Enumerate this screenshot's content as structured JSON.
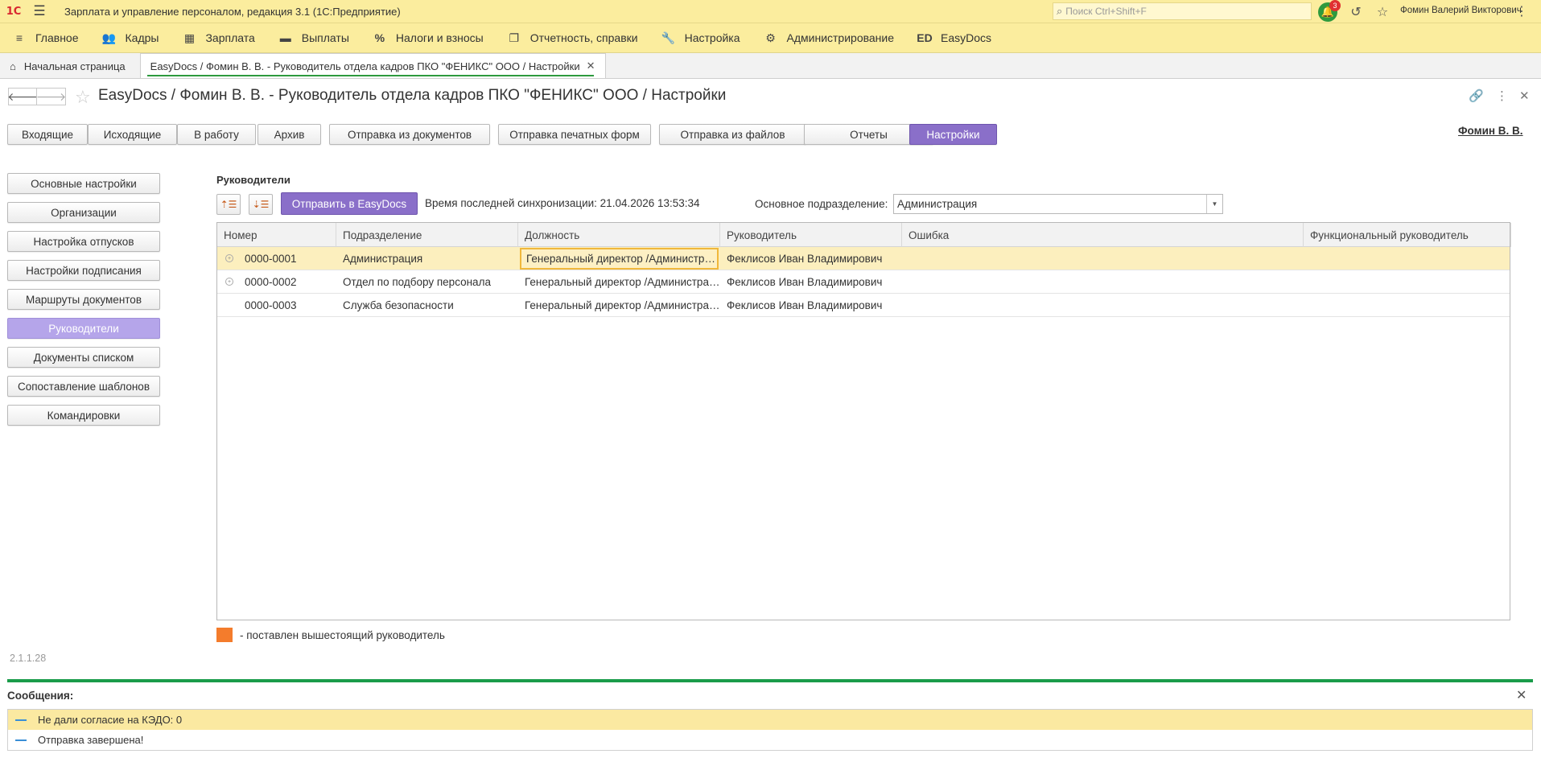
{
  "app": {
    "logo": "1С",
    "title": "Зарплата и управление персоналом, редакция 3.1  (1С:Предприятие)",
    "search_placeholder": "Поиск Ctrl+Shift+F",
    "notifications_count": "3",
    "user_name": "Фомин Валерий Викторович"
  },
  "sections": [
    {
      "label": "Главное",
      "icon": "≡",
      "icon_name": "menu-icon"
    },
    {
      "label": "Кадры",
      "icon": "👥",
      "icon_name": "people-icon"
    },
    {
      "label": "Зарплата",
      "icon": "▦",
      "icon_name": "calculator-icon"
    },
    {
      "label": "Выплаты",
      "icon": "▬",
      "icon_name": "wallet-icon"
    },
    {
      "label": "Налоги и взносы",
      "icon": "%",
      "icon_name": "percent-icon"
    },
    {
      "label": "Отчетность, справки",
      "icon": "❐",
      "icon_name": "documents-icon"
    },
    {
      "label": "Настройка",
      "icon": "🔧",
      "icon_name": "wrench-icon"
    },
    {
      "label": "Администрирование",
      "icon": "⚙",
      "icon_name": "gear-icon"
    },
    {
      "label": "EasyDocs",
      "icon": "ED",
      "icon_name": "easydocs-icon"
    }
  ],
  "open_tabs": {
    "home": "Начальная страница",
    "active": "EasyDocs / Фомин В. В. - Руководитель отдела кадров ПКО \"ФЕНИКС\" ООО / Настройки"
  },
  "form": {
    "title": "EasyDocs / Фомин В. В. - Руководитель отдела кадров ПКО \"ФЕНИКС\" ООО / Настройки",
    "user_link": "Фомин В. В.",
    "action_buttons": [
      "Входящие",
      "Исходящие",
      "В работу",
      "Архив",
      "Отправка из документов",
      "Отправка печатных форм",
      "Отправка из файлов",
      "Отчеты",
      "Настройки"
    ],
    "active_action": "Настройки"
  },
  "left_menu": {
    "items": [
      "Основные настройки",
      "Организации",
      "Настройка отпусков",
      "Настройки подписания",
      "Маршруты документов",
      "Руководители",
      "Документы списком",
      "Сопоставление шаблонов",
      "Командировки"
    ],
    "active": "Руководители",
    "version": "2.1.1.28"
  },
  "content": {
    "section_title": "Руководители",
    "send_button": "Отправить в EasyDocs",
    "sync_label": "Время последней синхронизации: 21.04.2026 13:53:34",
    "department_label": "Основное подразделение:",
    "department_value": "Администрация",
    "columns": [
      "Номер",
      "Подразделение",
      "Должность",
      "Руководитель",
      "Ошибка",
      "Функциональный руководитель"
    ],
    "rows": [
      {
        "number": "0000-0001",
        "department": "Администрация",
        "position": "Генеральный директор /Администрация",
        "manager": "Феклисов Иван Владимирович",
        "error": "",
        "functional": "",
        "expandable": true
      },
      {
        "number": "0000-0002",
        "department": "Отдел по подбору персонала",
        "position": "Генеральный директор /Администрация",
        "manager": "Феклисов Иван Владимирович",
        "error": "",
        "functional": "",
        "expandable": true
      },
      {
        "number": "0000-0003",
        "department": "Служба безопасности",
        "position": "Генеральный директор /Администрация",
        "manager": "Феклисов Иван Владимирович",
        "error": "",
        "functional": "",
        "expandable": false
      }
    ],
    "legend": "- поставлен вышестоящий руководитель",
    "legend_color": "#f47c2c"
  },
  "messages": {
    "title": "Сообщения:",
    "items": [
      "Не дали согласие на КЭДО: 0",
      "Отправка завершена!"
    ]
  },
  "colors": {
    "accent": "#8a6fc9",
    "accent_light": "#b5a5ea",
    "topbar": "#fbed9e",
    "selection": "#fcefbe",
    "message_line": "#1a9c4a"
  }
}
